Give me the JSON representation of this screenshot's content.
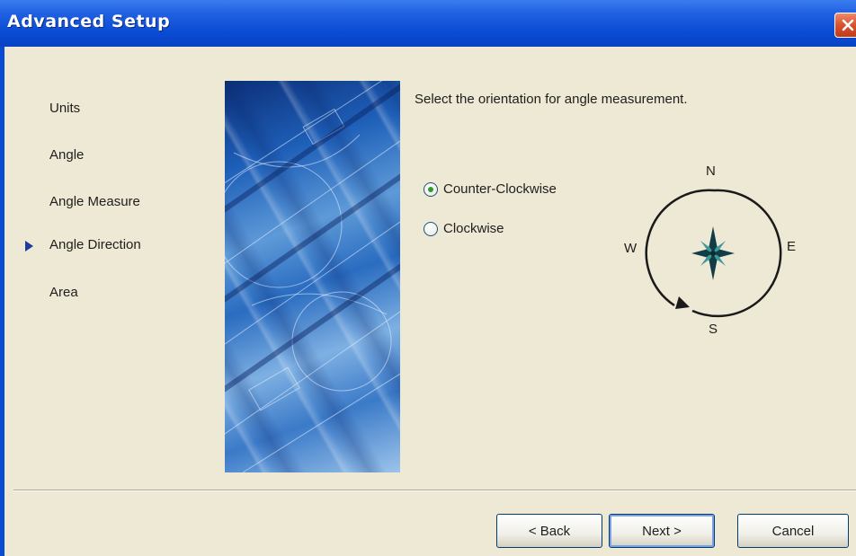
{
  "window": {
    "title": "Advanced Setup",
    "close_glyph": "✕"
  },
  "steps": [
    {
      "label": "Units",
      "current": false
    },
    {
      "label": "Angle",
      "current": false
    },
    {
      "label": "Angle Measure",
      "current": false
    },
    {
      "label": "Angle Direction",
      "current": true
    },
    {
      "label": "Area",
      "current": false
    }
  ],
  "main": {
    "prompt": "Select the orientation for angle measurement.",
    "options": [
      {
        "label": "Counter-Clockwise",
        "selected": true
      },
      {
        "label": "Clockwise",
        "selected": false
      }
    ],
    "compass": {
      "n": "N",
      "s": "S",
      "e": "E",
      "w": "W"
    }
  },
  "buttons": {
    "back": "< Back",
    "next": "Next >",
    "cancel": "Cancel"
  },
  "colors": {
    "titlebar": "#0a4bd4",
    "client_bg": "#ede9d4",
    "radio_dot": "#2c9a2c"
  }
}
